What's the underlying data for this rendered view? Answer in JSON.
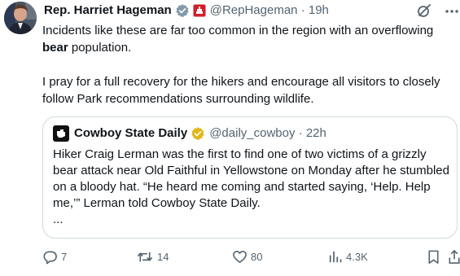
{
  "author": {
    "name": "Rep. Harriet Hageman",
    "handle": "@RepHageman",
    "separator": "·",
    "time": "19h"
  },
  "post": {
    "paragraph1_before": "Incidents like these are far too common in the region with an overflowing ",
    "paragraph1_bold": "bear",
    "paragraph1_after": " population.",
    "paragraph2": "I pray for a full recovery for the hikers and encourage all visitors to closely follow Park recommendations surrounding wildlife."
  },
  "quoted": {
    "name": "Cowboy State Daily",
    "handle": "@daily_cowboy",
    "separator": "·",
    "time": "22h",
    "text": "Hiker Craig Lerman was the first to find one of two victims of a grizzly bear attack near Old Faithful in Yellowstone on Monday after he stumbled on a bloody hat. “He heard me coming and started saying, ‘Help. Help me,’” Lerman told Cowboy State Daily.",
    "ellipsis": "..."
  },
  "stats": {
    "replies": "7",
    "reposts": "14",
    "likes": "80",
    "views": "4.3K"
  },
  "colors": {
    "text": "#0f1419",
    "secondary": "#536471",
    "border": "#cfd9de",
    "verified_gray": "#829aab",
    "verified_gold": "#e2b719",
    "house_badge": "#d11f2c"
  },
  "icons": {
    "verified": "verified-badge-icon",
    "affiliate": "house-badge-icon",
    "grok": "grok-icon",
    "more": "more-icon",
    "reply": "reply-icon",
    "repost": "repost-icon",
    "like": "like-icon",
    "views": "views-icon",
    "bookmark": "bookmark-icon",
    "share": "share-icon"
  }
}
